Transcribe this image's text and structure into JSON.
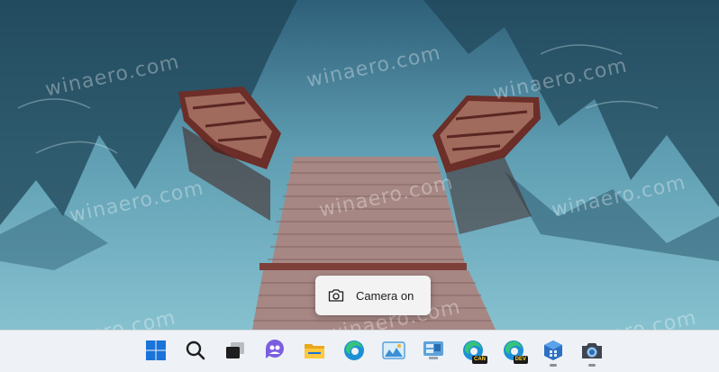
{
  "watermark_text": "winaero.com",
  "toast": {
    "label": "Camera on",
    "icon": "camera-icon"
  },
  "taskbar": {
    "icons": [
      {
        "name": "start-icon",
        "running": false
      },
      {
        "name": "search-icon",
        "running": false
      },
      {
        "name": "task-view-icon",
        "running": false
      },
      {
        "name": "chat-icon",
        "running": false
      },
      {
        "name": "file-explorer-icon",
        "running": false
      },
      {
        "name": "edge-icon",
        "running": false
      },
      {
        "name": "photos-icon",
        "running": false
      },
      {
        "name": "control-panel-icon",
        "running": false
      },
      {
        "name": "edge-canary-icon",
        "badge": "CAN",
        "running": false
      },
      {
        "name": "edge-dev-icon",
        "badge": "DEV",
        "running": false
      },
      {
        "name": "app-installer-icon",
        "running": true
      },
      {
        "name": "camera-app-icon",
        "running": true
      }
    ]
  },
  "colors": {
    "taskbar_bg": "#eef1f5",
    "toast_bg": "#f3f3f3",
    "windows_blue": "#1a73d9"
  }
}
